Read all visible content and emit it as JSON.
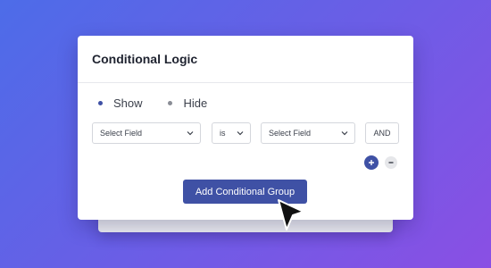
{
  "panel": {
    "title": "Conditional Logic",
    "visibility": {
      "options": [
        {
          "label": "Show",
          "selected": true
        },
        {
          "label": "Hide",
          "selected": false
        }
      ]
    },
    "rule": {
      "field_select": "Select Field",
      "operator_select": "is",
      "value_select": "Select Field",
      "join_label": "AND"
    },
    "add_rule_icon": "plus-icon",
    "remove_rule_icon": "minus-icon",
    "add_group_label": "Add Conditional Group"
  },
  "colors": {
    "accent": "#3f51a5",
    "background_start": "#4d6ce8",
    "background_end": "#8a4fe4"
  },
  "pointer_icon": "mouse-pointer-icon"
}
